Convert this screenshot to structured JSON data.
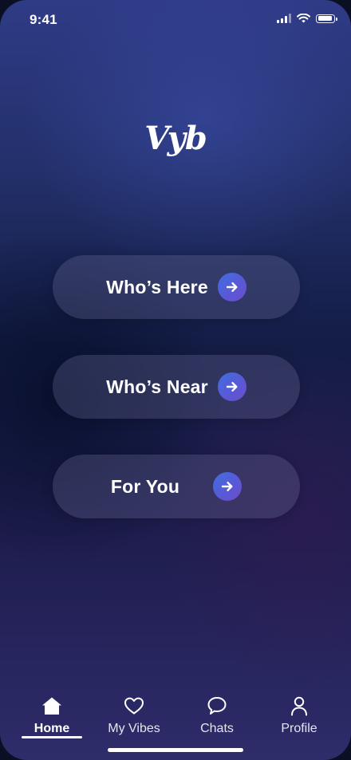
{
  "status_bar": {
    "time": "9:41",
    "icons": [
      "cellular-signal-icon",
      "wifi-icon",
      "battery-icon"
    ]
  },
  "app": {
    "logo_text": "Vyb"
  },
  "actions": [
    {
      "label": "Who’s Here",
      "icon": "arrow-right-icon"
    },
    {
      "label": "Who’s Near",
      "icon": "arrow-right-icon"
    },
    {
      "label": "For You",
      "icon": "arrow-right-icon"
    }
  ],
  "tab_bar": {
    "active": "Home",
    "tabs": [
      {
        "label": "Home",
        "icon": "home-icon"
      },
      {
        "label": "My Vibes",
        "icon": "heart-icon"
      },
      {
        "label": "Chats",
        "icon": "chat-bubble-icon"
      },
      {
        "label": "Profile",
        "icon": "person-icon"
      }
    ]
  },
  "colors": {
    "accent_gradient_start": "#3f6fe0",
    "accent_gradient_end": "#6d4fc8",
    "background_top": "#2f3b86",
    "background_bottom": "#2e2c6a"
  }
}
